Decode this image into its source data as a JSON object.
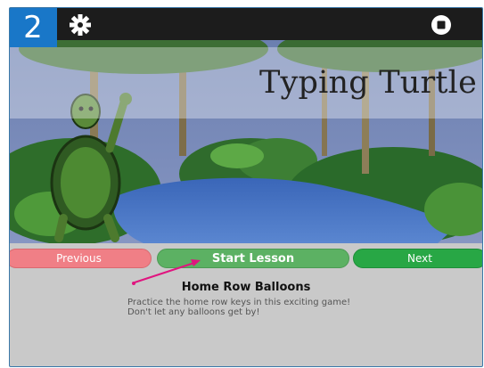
{
  "header": {
    "step_number": "2",
    "settings_icon": "gear-icon",
    "stop_icon": "stop-icon"
  },
  "banner": {
    "title": "Typing Turtle"
  },
  "nav": {
    "previous_label": "Previous",
    "start_label": "Start Lesson",
    "next_label": "Next"
  },
  "lesson": {
    "name": "Home Row Balloons",
    "description_line1": "Practice the home row keys in this exciting game!",
    "description_line2": "Don't let any balloons get by!"
  },
  "colors": {
    "badge": "#1977c8",
    "previous": "#f07f86",
    "start": "#5cb163",
    "next": "#28a745",
    "arrow": "#e0157f"
  }
}
